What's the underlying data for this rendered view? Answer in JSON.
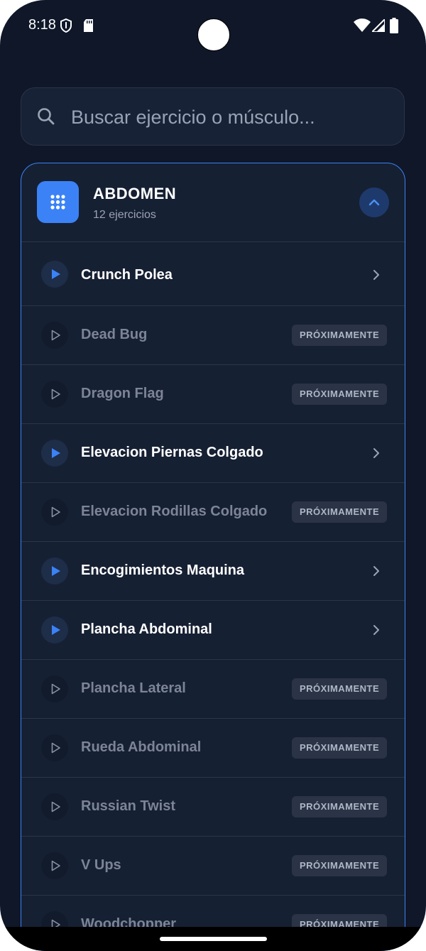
{
  "status_bar": {
    "time": "8:18",
    "icons": [
      "shield-icon",
      "sd-card-icon",
      "wifi-icon",
      "signal-icon",
      "battery-icon"
    ]
  },
  "search": {
    "placeholder": "Buscar ejercicio o músculo...",
    "value": ""
  },
  "category": {
    "title": "ABDOMEN",
    "count": "12 ejercicios",
    "icon": "grid-icon",
    "expanded": true
  },
  "exercises": [
    {
      "label": "Crunch Polea",
      "available": true
    },
    {
      "label": "Dead Bug",
      "available": false,
      "badge": "PRÓXIMAMENTE"
    },
    {
      "label": "Dragon Flag",
      "available": false,
      "badge": "PRÓXIMAMENTE"
    },
    {
      "label": "Elevacion Piernas Colgado",
      "available": true
    },
    {
      "label": "Elevacion Rodillas Colgado",
      "available": false,
      "badge": "PRÓXIMAMENTE"
    },
    {
      "label": "Encogimientos Maquina",
      "available": true
    },
    {
      "label": "Plancha Abdominal",
      "available": true
    },
    {
      "label": "Plancha Lateral",
      "available": false,
      "badge": "PRÓXIMAMENTE"
    },
    {
      "label": "Rueda Abdominal",
      "available": false,
      "badge": "PRÓXIMAMENTE"
    },
    {
      "label": "Russian Twist",
      "available": false,
      "badge": "PRÓXIMAMENTE"
    },
    {
      "label": "V Ups",
      "available": false,
      "badge": "PRÓXIMAMENTE"
    },
    {
      "label": "Woodchopper",
      "available": false,
      "badge": "PRÓXIMAMENTE"
    }
  ],
  "colors": {
    "background": "#0f1729",
    "card": "#162033",
    "accent": "#3b82f6",
    "text_active": "#ffffff",
    "text_inactive": "#7c8597"
  }
}
